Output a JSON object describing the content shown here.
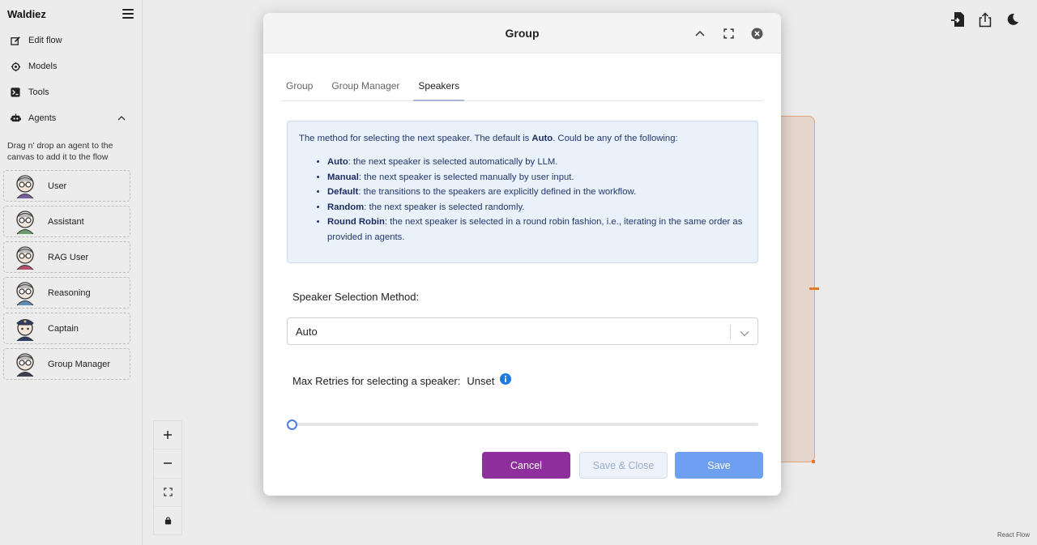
{
  "sidebar": {
    "brand": "Waldiez",
    "nav": [
      {
        "label": "Edit flow",
        "icon": "edit-icon"
      },
      {
        "label": "Models",
        "icon": "models-icon"
      },
      {
        "label": "Tools",
        "icon": "terminal-icon"
      },
      {
        "label": "Agents",
        "icon": "robot-icon"
      }
    ],
    "hint": "Drag n' drop an agent to the canvas to add it to the flow",
    "agents": [
      {
        "label": "User"
      },
      {
        "label": "Assistant"
      },
      {
        "label": "RAG User"
      },
      {
        "label": "Reasoning"
      },
      {
        "label": "Captain"
      },
      {
        "label": "Group Manager"
      }
    ]
  },
  "canvas": {
    "attribution": "React Flow",
    "controls": [
      "zoom-in",
      "zoom-out",
      "fit-view",
      "lock"
    ],
    "top_icons": [
      "import-icon",
      "share-icon",
      "dark-mode-icon"
    ]
  },
  "modal": {
    "title": "Group",
    "tabs": [
      {
        "label": "Group",
        "active": false
      },
      {
        "label": "Group Manager",
        "active": false
      },
      {
        "label": "Speakers",
        "active": true
      }
    ],
    "info": {
      "intro_prefix": "The method for selecting the next speaker. The default is ",
      "intro_bold": "Auto",
      "intro_suffix": ". Could be any of the following:",
      "items": [
        {
          "term": "Auto",
          "desc": ": the next speaker is selected automatically by LLM."
        },
        {
          "term": "Manual",
          "desc": ": the next speaker is selected manually by user input."
        },
        {
          "term": "Default",
          "desc": ": the transitions to the speakers are explicitly defined in the workflow."
        },
        {
          "term": "Random",
          "desc": ": the next speaker is selected randomly."
        },
        {
          "term": "Round Robin",
          "desc": ": the next speaker is selected in a round robin fashion, i.e., iterating in the same order as provided in agents."
        }
      ]
    },
    "speaker_method_label": "Speaker Selection Method:",
    "speaker_method_value": "Auto",
    "max_retries_label": "Max Retries for selecting a speaker:",
    "max_retries_value": "Unset",
    "slider_value_fraction": 0,
    "buttons": {
      "cancel": "Cancel",
      "save_close": "Save & Close",
      "save": "Save"
    }
  },
  "colors": {
    "primary": "#8f2f9d",
    "save": "#6f9ff0",
    "info_bg": "#e9f1fb",
    "info_text": "#24366a",
    "accent_node": "#e07a2f"
  }
}
